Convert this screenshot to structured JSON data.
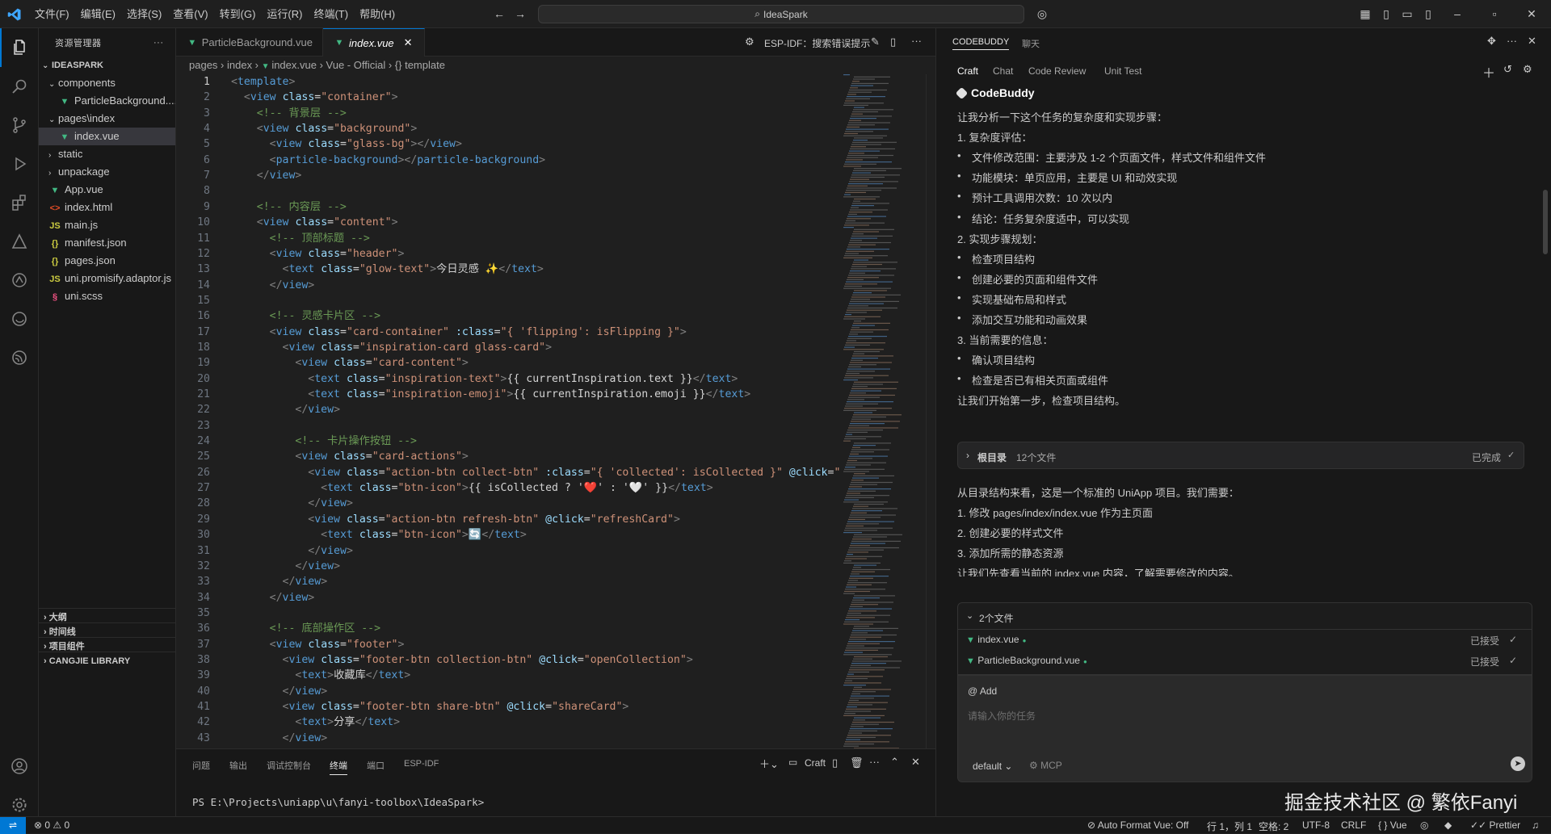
{
  "menu": [
    "文件(F)",
    "编辑(E)",
    "选择(S)",
    "查看(V)",
    "转到(G)",
    "运行(R)",
    "终端(T)",
    "帮助(H)"
  ],
  "search": {
    "label": "IdeaSpark"
  },
  "sidebar": {
    "title": "资源管理器",
    "project": "IDEASPARK",
    "items": [
      {
        "label": "components",
        "icon": "chevron-down"
      },
      {
        "label": "ParticleBackground....",
        "icon": "vue"
      },
      {
        "label": "pages\\index",
        "icon": "chevron-down"
      },
      {
        "label": "index.vue",
        "icon": "vue"
      },
      {
        "label": "static",
        "icon": "chevron-right"
      },
      {
        "label": "unpackage",
        "icon": "chevron-right"
      },
      {
        "label": "App.vue",
        "icon": "vue"
      },
      {
        "label": "index.html",
        "icon": "html"
      },
      {
        "label": "main.js",
        "icon": "js"
      },
      {
        "label": "manifest.json",
        "icon": "json"
      },
      {
        "label": "pages.json",
        "icon": "json"
      },
      {
        "label": "uni.promisify.adaptor.js",
        "icon": "js"
      },
      {
        "label": "uni.scss",
        "icon": "scss"
      }
    ],
    "sections": [
      "大纲",
      "时间线",
      "项目组件",
      "CANGJIE LIBRARY"
    ]
  },
  "tabs": [
    {
      "label": "ParticleBackground.vue"
    },
    {
      "label": "index.vue"
    }
  ],
  "editor_toolbar": {
    "label": "ESP-IDF：搜索错误提示"
  },
  "breadcrumb": [
    "pages",
    "index",
    "index.vue",
    "Vue - Official",
    "{} template"
  ],
  "code": [
    "<template>",
    "  <view class=\"container\">",
    "    <!-- 背景层 -->",
    "    <view class=\"background\">",
    "      <view class=\"glass-bg\"></view>",
    "      <particle-background></particle-background>",
    "    </view>",
    "",
    "    <!-- 内容层 -->",
    "    <view class=\"content\">",
    "      <!-- 顶部标题 -->",
    "      <view class=\"header\">",
    "        <text class=\"glow-text\">今日灵感 ✨</text>",
    "      </view>",
    "",
    "      <!-- 灵感卡片区 -->",
    "      <view class=\"card-container\" :class=\"{ 'flipping': isFlipping }\">",
    "        <view class=\"inspiration-card glass-card\">",
    "          <view class=\"card-content\">",
    "            <text class=\"inspiration-text\">{{ currentInspiration.text }}</text>",
    "            <text class=\"inspiration-emoji\">{{ currentInspiration.emoji }}</text>",
    "          </view>",
    "",
    "          <!-- 卡片操作按钮 -->",
    "          <view class=\"card-actions\">",
    "            <view class=\"action-btn collect-btn\" :class=\"{ 'collected': isCollected }\" @click=\"tog",
    "              <text class=\"btn-icon\">{{ isCollected ? '❤️' : '🤍' }}</text>",
    "            </view>",
    "            <view class=\"action-btn refresh-btn\" @click=\"refreshCard\">",
    "              <text class=\"btn-icon\">🔄</text>",
    "            </view>",
    "          </view>",
    "        </view>",
    "      </view>",
    "",
    "      <!-- 底部操作区 -->",
    "      <view class=\"footer\">",
    "        <view class=\"footer-btn collection-btn\" @click=\"openCollection\">",
    "          <text>收藏库</text>",
    "        </view>",
    "        <view class=\"footer-btn share-btn\" @click=\"shareCard\">",
    "          <text>分享</text>",
    "        </view>",
    "      </view>"
  ],
  "panel": {
    "tabs": [
      "问题",
      "输出",
      "调试控制台",
      "终端",
      "端口",
      "ESP-IDF"
    ],
    "active": "终端",
    "craft_label": "Craft",
    "terminal_line": "PS E:\\Projects\\uniapp\\u\\fanyi-toolbox\\IdeaSpark>"
  },
  "chat": {
    "header_tabs": [
      "CODEBUDDY",
      "聊天"
    ],
    "sub_tabs": [
      "Craft",
      "Chat",
      "Code Review",
      "Unit Test"
    ],
    "assistant": "CodeBuddy",
    "lines": [
      {
        "type": "text",
        "text": "让我分析一下这个任务的复杂度和实现步骤："
      },
      {
        "type": "text",
        "text": "1. 复杂度评估："
      },
      {
        "type": "bullet",
        "text": "文件修改范围：主要涉及 1-2 个页面文件，样式文件和组件文件"
      },
      {
        "type": "bullet",
        "text": "功能模块：单页应用，主要是 UI 和动效实现"
      },
      {
        "type": "bullet",
        "text": "预计工具调用次数：10 次以内"
      },
      {
        "type": "bullet",
        "text": "结论：任务复杂度适中，可以实现"
      },
      {
        "type": "text",
        "text": "2. 实现步骤规划："
      },
      {
        "type": "bullet",
        "text": "检查项目结构"
      },
      {
        "type": "bullet",
        "text": "创建必要的页面和组件文件"
      },
      {
        "type": "bullet",
        "text": "实现基础布局和样式"
      },
      {
        "type": "bullet",
        "text": "添加交互功能和动画效果"
      },
      {
        "type": "text",
        "text": "3. 当前需要的信息："
      },
      {
        "type": "bullet",
        "text": "确认项目结构"
      },
      {
        "type": "bullet",
        "text": "检查是否已有相关页面或组件"
      },
      {
        "type": "text",
        "text": "让我们开始第一步，检查项目结构。"
      }
    ],
    "dir_card": {
      "title": "根目录",
      "count": "12个文件",
      "status": "已完成"
    },
    "lines2": [
      "从目录结构来看，这是一个标准的 UniApp 项目。我们需要：",
      "1. 修改 pages/index/index.vue 作为主页面",
      "2. 创建必要的样式文件",
      "3. 添加所需的静态资源",
      "让我们先查看当前的 index.vue 内容，了解需要修改的内容。"
    ],
    "files_card": {
      "title": "2个文件",
      "files": [
        {
          "name": "index.vue",
          "status": "已接受"
        },
        {
          "name": "ParticleBackground.vue",
          "status": "已接受"
        }
      ]
    },
    "input": {
      "add": "@ Add",
      "placeholder": "请输入你的任务",
      "mode": "default",
      "mcp": "MCP"
    }
  },
  "watermark": "掘金技术社区 @ 繁依Fanyi",
  "status": {
    "errors": "0",
    "warnings": "0",
    "right": [
      "Auto Format Vue: Off",
      "行 1，列 1",
      "空格: 2",
      "UTF-8",
      "CRLF",
      "Vue",
      "Prettier"
    ]
  },
  "colors": {
    "accent": "#0078d4",
    "vue": "#42b883",
    "bg": "#1f1f1f",
    "sidebar": "#181818"
  }
}
